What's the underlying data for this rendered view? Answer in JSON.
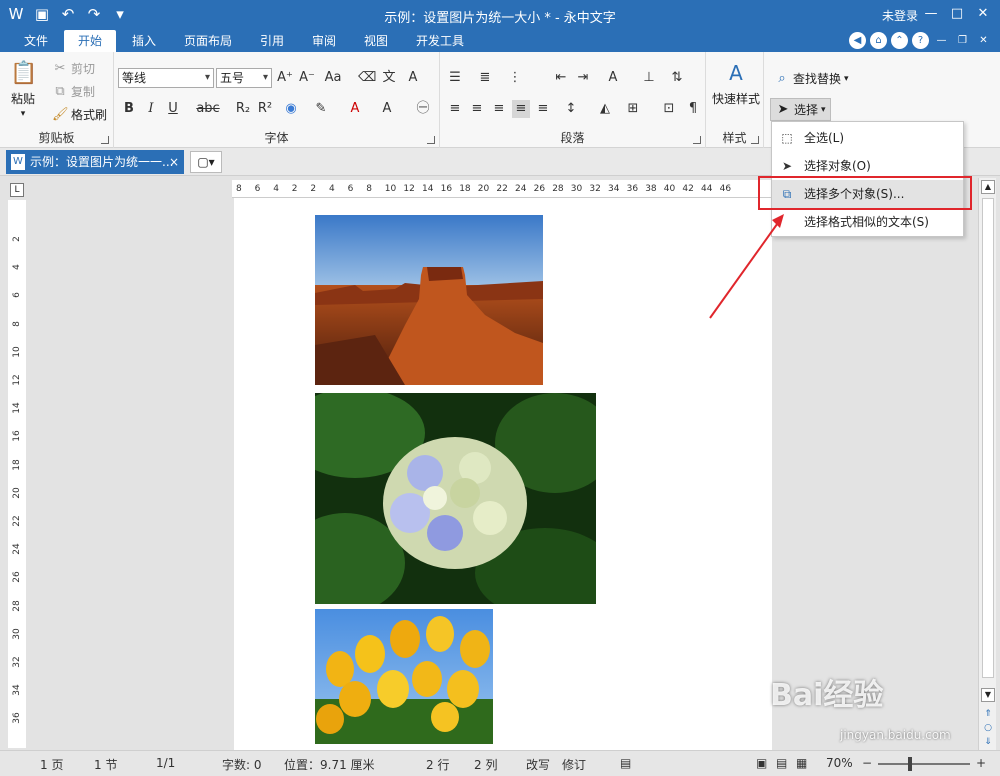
{
  "window": {
    "title": "示例：设置图片为统一大小 * - 永中文字",
    "login": "未登录",
    "qat_icons": [
      "app-logo-icon",
      "save-icon",
      "undo-icon",
      "redo-icon",
      "customize-icon"
    ]
  },
  "tabs": [
    "文件",
    "开始",
    "插入",
    "页面布局",
    "引用",
    "审阅",
    "视图",
    "开发工具"
  ],
  "active_tab": "开始",
  "ribbon": {
    "clipboard": {
      "label": "剪贴板",
      "paste": "粘贴",
      "cut": "剪切",
      "copy": "复制",
      "format_painter": "格式刷"
    },
    "font": {
      "label": "字体",
      "font_name": "等线",
      "font_size": "五号"
    },
    "paragraph": {
      "label": "段落"
    },
    "styles": {
      "label": "样式",
      "quick_styles": "快速样式"
    },
    "editing": {
      "find_replace": "查找替换",
      "select": "选择"
    }
  },
  "select_menu": {
    "items": [
      {
        "label": "全选(L)"
      },
      {
        "label": "选择对象(O)"
      },
      {
        "label": "选择多个对象(S)..."
      },
      {
        "label": "选择格式相似的文本(S)"
      }
    ],
    "highlighted_index": 2
  },
  "doc_tab": {
    "title": "示例：设置图片为统一一...",
    "close": "×"
  },
  "ruler": {
    "h_ticks": [
      "8",
      "6",
      "4",
      "2",
      "2",
      "4",
      "6",
      "8",
      "10",
      "12",
      "14",
      "16",
      "18",
      "20",
      "22",
      "24",
      "26",
      "28",
      "30",
      "32",
      "34",
      "36",
      "38",
      "40",
      "42",
      "44",
      "46"
    ],
    "v_ticks": [
      "2",
      "4",
      "6",
      "8",
      "10",
      "12",
      "14",
      "16",
      "18",
      "20",
      "22",
      "24",
      "26",
      "28",
      "30",
      "32",
      "34",
      "36"
    ],
    "corner": "L"
  },
  "status": {
    "page": "1 页",
    "section": "1 节",
    "pages": "1/1",
    "words": "字数: 0",
    "position": "位置：9.71 厘米",
    "line": "2 行",
    "column": "2 列",
    "overwrite": "改写",
    "revise": "修订",
    "zoom": "70%"
  },
  "watermark": {
    "brand": "Bai经验",
    "url": "jingyan.baidu.com"
  },
  "colors": {
    "accent": "#2b6fb6",
    "highlight_box": "#e0262c"
  }
}
